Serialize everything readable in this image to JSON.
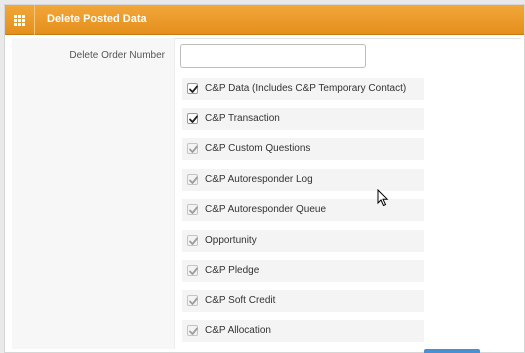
{
  "panel": {
    "title": "Delete Posted Data",
    "header_icon": "grid-icon"
  },
  "form": {
    "order_label": "Delete Order Number",
    "order_value": "",
    "order_placeholder": ""
  },
  "options": [
    {
      "label": "C&P Data (Includes C&P Temporary Contact)",
      "checked": true,
      "enabled": true
    },
    {
      "label": "C&P Transaction",
      "checked": true,
      "enabled": true
    },
    {
      "label": "C&P Custom Questions",
      "checked": true,
      "enabled": false
    },
    {
      "label": "C&P Autoresponder Log",
      "checked": true,
      "enabled": false
    },
    {
      "label": "C&P Autoresponder Queue",
      "checked": true,
      "enabled": false
    },
    {
      "label": "Opportunity",
      "checked": true,
      "enabled": false
    },
    {
      "label": "C&P Pledge",
      "checked": true,
      "enabled": false
    },
    {
      "label": "C&P Soft Credit",
      "checked": true,
      "enabled": false
    },
    {
      "label": "C&P Allocation",
      "checked": true,
      "enabled": false
    }
  ],
  "colors": {
    "header": "#e8951f",
    "check_enabled": "#222222",
    "check_disabled": "#9d9d9d"
  }
}
